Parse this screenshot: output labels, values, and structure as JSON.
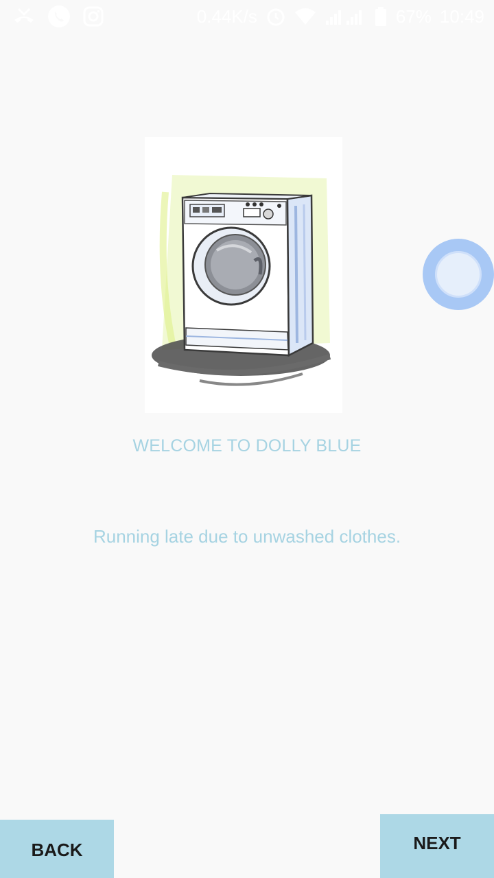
{
  "status_bar": {
    "network_speed": "0.44K/s",
    "battery_percent": "67%",
    "time": "10:49",
    "icons": [
      "missed-call-icon",
      "whatsapp-icon",
      "instagram-icon",
      "alarm-icon",
      "wifi-icon",
      "signal-icon",
      "battery-icon"
    ]
  },
  "illustration": {
    "subject": "washing-machine-illustration"
  },
  "main": {
    "title": "WELCOME TO DOLLY BLUE",
    "subtitle": "Running late due to unwashed clothes."
  },
  "nav": {
    "back_label": "BACK",
    "next_label": "NEXT"
  },
  "colors": {
    "accent_text": "#a6d3e2",
    "button_bg": "#add8e6",
    "bubble": "#a8c8f5",
    "background": "#f9f9f9"
  }
}
